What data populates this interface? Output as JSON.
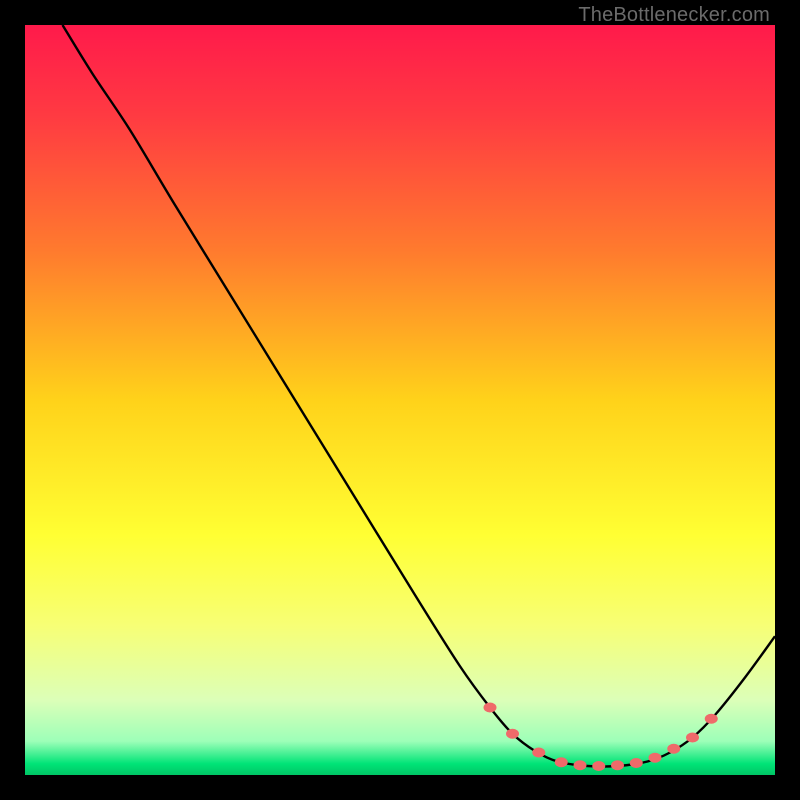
{
  "attribution": "TheBottlenecker.com",
  "chart_data": {
    "type": "line",
    "title": "",
    "xlabel": "",
    "ylabel": "",
    "xlim": [
      0,
      100
    ],
    "ylim": [
      0,
      100
    ],
    "background_gradient": {
      "stops": [
        {
          "offset": 0.0,
          "color": "#ff1a4b"
        },
        {
          "offset": 0.12,
          "color": "#ff3a42"
        },
        {
          "offset": 0.3,
          "color": "#ff7a2e"
        },
        {
          "offset": 0.5,
          "color": "#ffd21a"
        },
        {
          "offset": 0.68,
          "color": "#ffff33"
        },
        {
          "offset": 0.8,
          "color": "#f7ff75"
        },
        {
          "offset": 0.9,
          "color": "#dcffb8"
        },
        {
          "offset": 0.955,
          "color": "#9dffb8"
        },
        {
          "offset": 0.985,
          "color": "#00e477"
        },
        {
          "offset": 1.0,
          "color": "#00c565"
        }
      ]
    },
    "series": [
      {
        "name": "bottleneck-curve",
        "color": "#000000",
        "width": 2.4,
        "points": [
          {
            "x": 5.0,
            "y": 100.0
          },
          {
            "x": 9.0,
            "y": 93.5
          },
          {
            "x": 14.0,
            "y": 86.0
          },
          {
            "x": 20.0,
            "y": 76.0
          },
          {
            "x": 28.0,
            "y": 63.0
          },
          {
            "x": 36.0,
            "y": 50.0
          },
          {
            "x": 44.0,
            "y": 37.0
          },
          {
            "x": 52.0,
            "y": 24.0
          },
          {
            "x": 58.0,
            "y": 14.5
          },
          {
            "x": 62.0,
            "y": 9.0
          },
          {
            "x": 65.0,
            "y": 5.5
          },
          {
            "x": 68.0,
            "y": 3.2
          },
          {
            "x": 71.0,
            "y": 1.8
          },
          {
            "x": 75.0,
            "y": 1.2
          },
          {
            "x": 79.0,
            "y": 1.2
          },
          {
            "x": 83.0,
            "y": 1.8
          },
          {
            "x": 86.0,
            "y": 3.0
          },
          {
            "x": 89.0,
            "y": 5.0
          },
          {
            "x": 92.0,
            "y": 8.0
          },
          {
            "x": 96.0,
            "y": 13.0
          },
          {
            "x": 100.0,
            "y": 18.5
          }
        ]
      }
    ],
    "markers": {
      "name": "highlighted-range",
      "color": "#ef6a6a",
      "rx": 6.5,
      "ry": 5.0,
      "points": [
        {
          "x": 62.0,
          "y": 9.0
        },
        {
          "x": 65.0,
          "y": 5.5
        },
        {
          "x": 68.5,
          "y": 3.0
        },
        {
          "x": 71.5,
          "y": 1.7
        },
        {
          "x": 74.0,
          "y": 1.3
        },
        {
          "x": 76.5,
          "y": 1.2
        },
        {
          "x": 79.0,
          "y": 1.3
        },
        {
          "x": 81.5,
          "y": 1.6
        },
        {
          "x": 84.0,
          "y": 2.3
        },
        {
          "x": 86.5,
          "y": 3.5
        },
        {
          "x": 89.0,
          "y": 5.0
        },
        {
          "x": 91.5,
          "y": 7.5
        }
      ]
    }
  }
}
